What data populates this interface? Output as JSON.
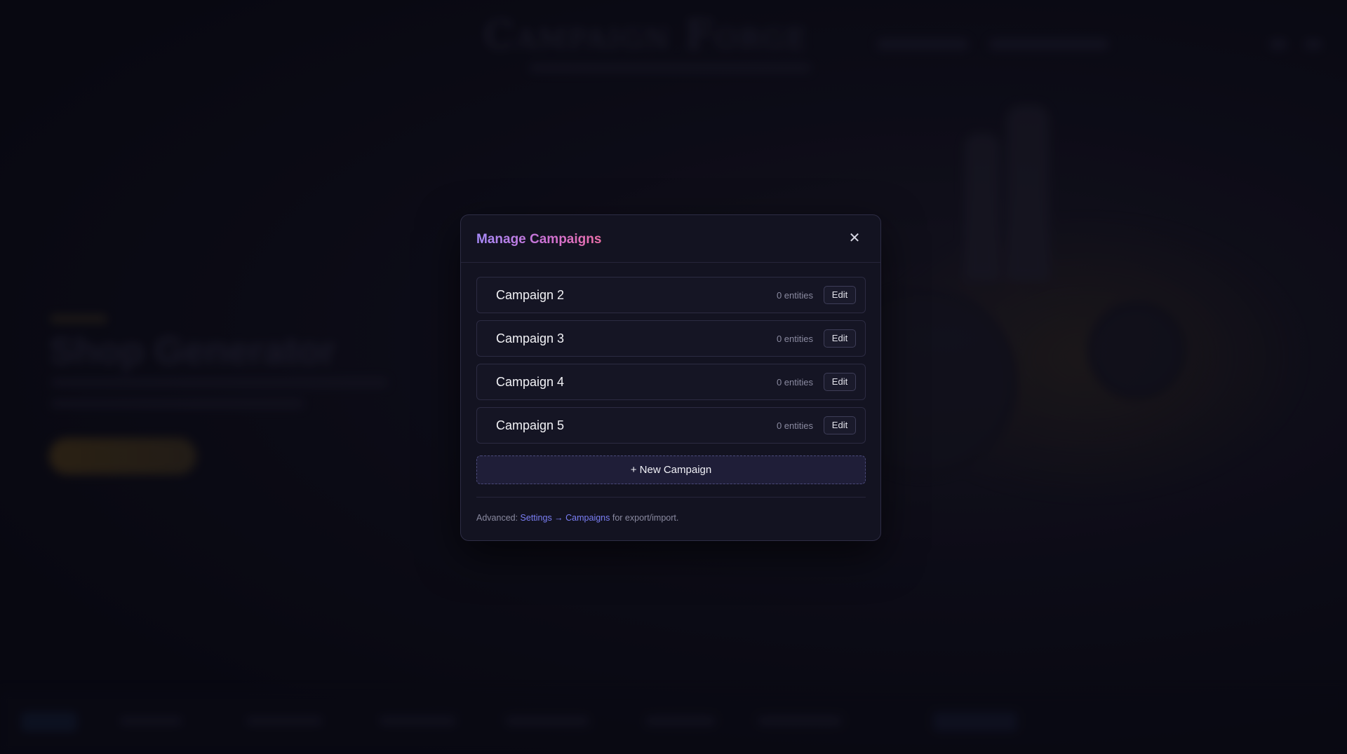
{
  "background": {
    "app_title": "Campaign Forge",
    "hero_title": "Shop Generator"
  },
  "modal": {
    "title": "Manage Campaigns",
    "close_icon": "close-icon",
    "campaigns": [
      {
        "name": "Campaign 2",
        "count": "0 entities",
        "edit_label": "Edit"
      },
      {
        "name": "Campaign 3",
        "count": "0 entities",
        "edit_label": "Edit"
      },
      {
        "name": "Campaign 4",
        "count": "0 entities",
        "edit_label": "Edit"
      },
      {
        "name": "Campaign 5",
        "count": "0 entities",
        "edit_label": "Edit"
      }
    ],
    "new_campaign_label": "+ New Campaign",
    "footnote": {
      "prefix": "Advanced: ",
      "link_text": "Settings → Campaigns",
      "suffix": " for export/import."
    }
  },
  "colors": {
    "title_gradient_start": "#a78bfa",
    "title_gradient_end": "#ec6fa8",
    "link": "#7b7ff5",
    "modal_bg": "#131321"
  }
}
